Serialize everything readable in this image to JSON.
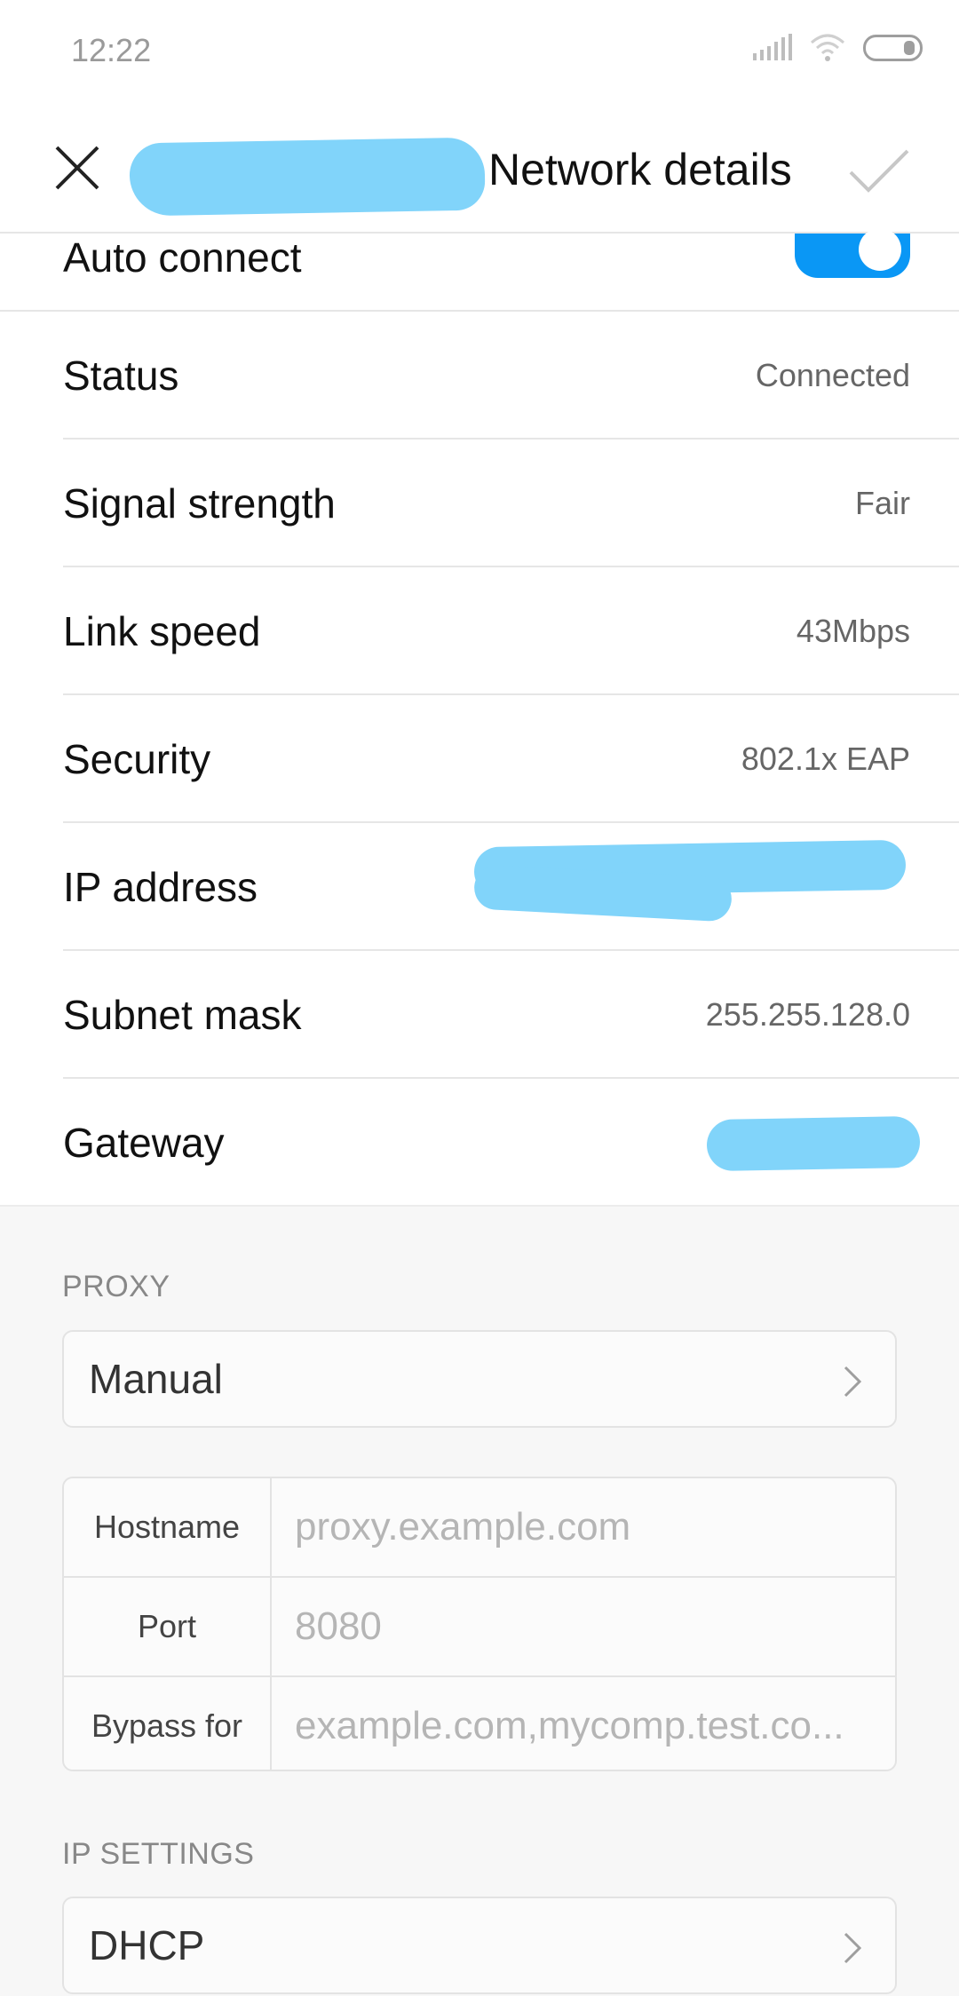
{
  "status_bar": {
    "time": "12:22"
  },
  "title_bar": {
    "title": "Network  details"
  },
  "auto_connect": {
    "label": "Auto connect",
    "enabled": true
  },
  "details": [
    {
      "label": "Status",
      "value": "Connected"
    },
    {
      "label": "Signal strength",
      "value": "Fair"
    },
    {
      "label": "Link speed",
      "value": "43Mbps"
    },
    {
      "label": "Security",
      "value": "802.1x EAP"
    },
    {
      "label": "IP address",
      "value": ""
    },
    {
      "label": "Subnet mask",
      "value": "255.255.128.0"
    },
    {
      "label": "Gateway",
      "value": ""
    }
  ],
  "proxy": {
    "header": "PROXY",
    "selected": "Manual",
    "fields": [
      {
        "label": "Hostname",
        "placeholder": "proxy.example.com"
      },
      {
        "label": "Port",
        "placeholder": "8080"
      },
      {
        "label": "Bypass for",
        "placeholder": "example.com,mycomp.test.co..."
      }
    ]
  },
  "ip_settings": {
    "header": "IP SETTINGS",
    "selected": "DHCP"
  },
  "colors": {
    "accent": "#0a97f5",
    "redaction": "#81d4fa"
  }
}
